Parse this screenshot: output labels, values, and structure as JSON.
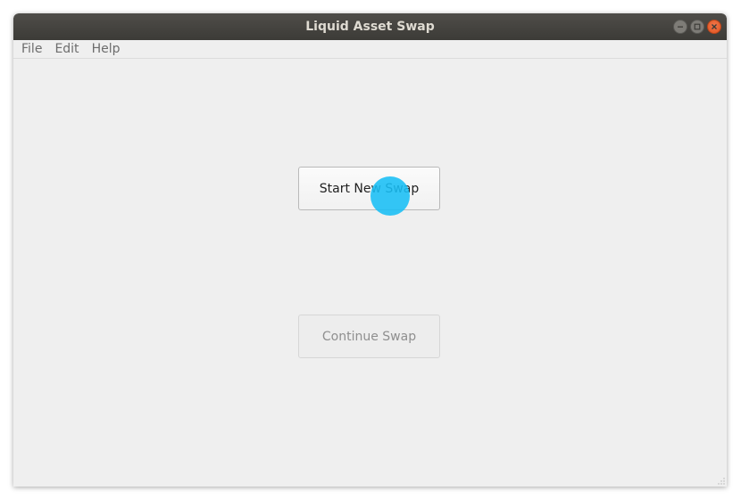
{
  "window": {
    "title": "Liquid Asset Swap"
  },
  "menubar": {
    "items": [
      {
        "label": "File"
      },
      {
        "label": "Edit"
      },
      {
        "label": "Help"
      }
    ]
  },
  "main": {
    "start_button_label": "Start New Swap",
    "continue_button_label": "Continue Swap",
    "continue_button_enabled": false
  },
  "icons": {
    "minimize": "minimize-icon",
    "maximize": "maximize-icon",
    "close": "close-icon",
    "resize_grip": "resize-grip-icon"
  },
  "colors": {
    "titlebar": "#3c3b37",
    "close_button": "#e0531f",
    "cursor_highlight": "#18bef5",
    "window_background": "#efefef"
  }
}
